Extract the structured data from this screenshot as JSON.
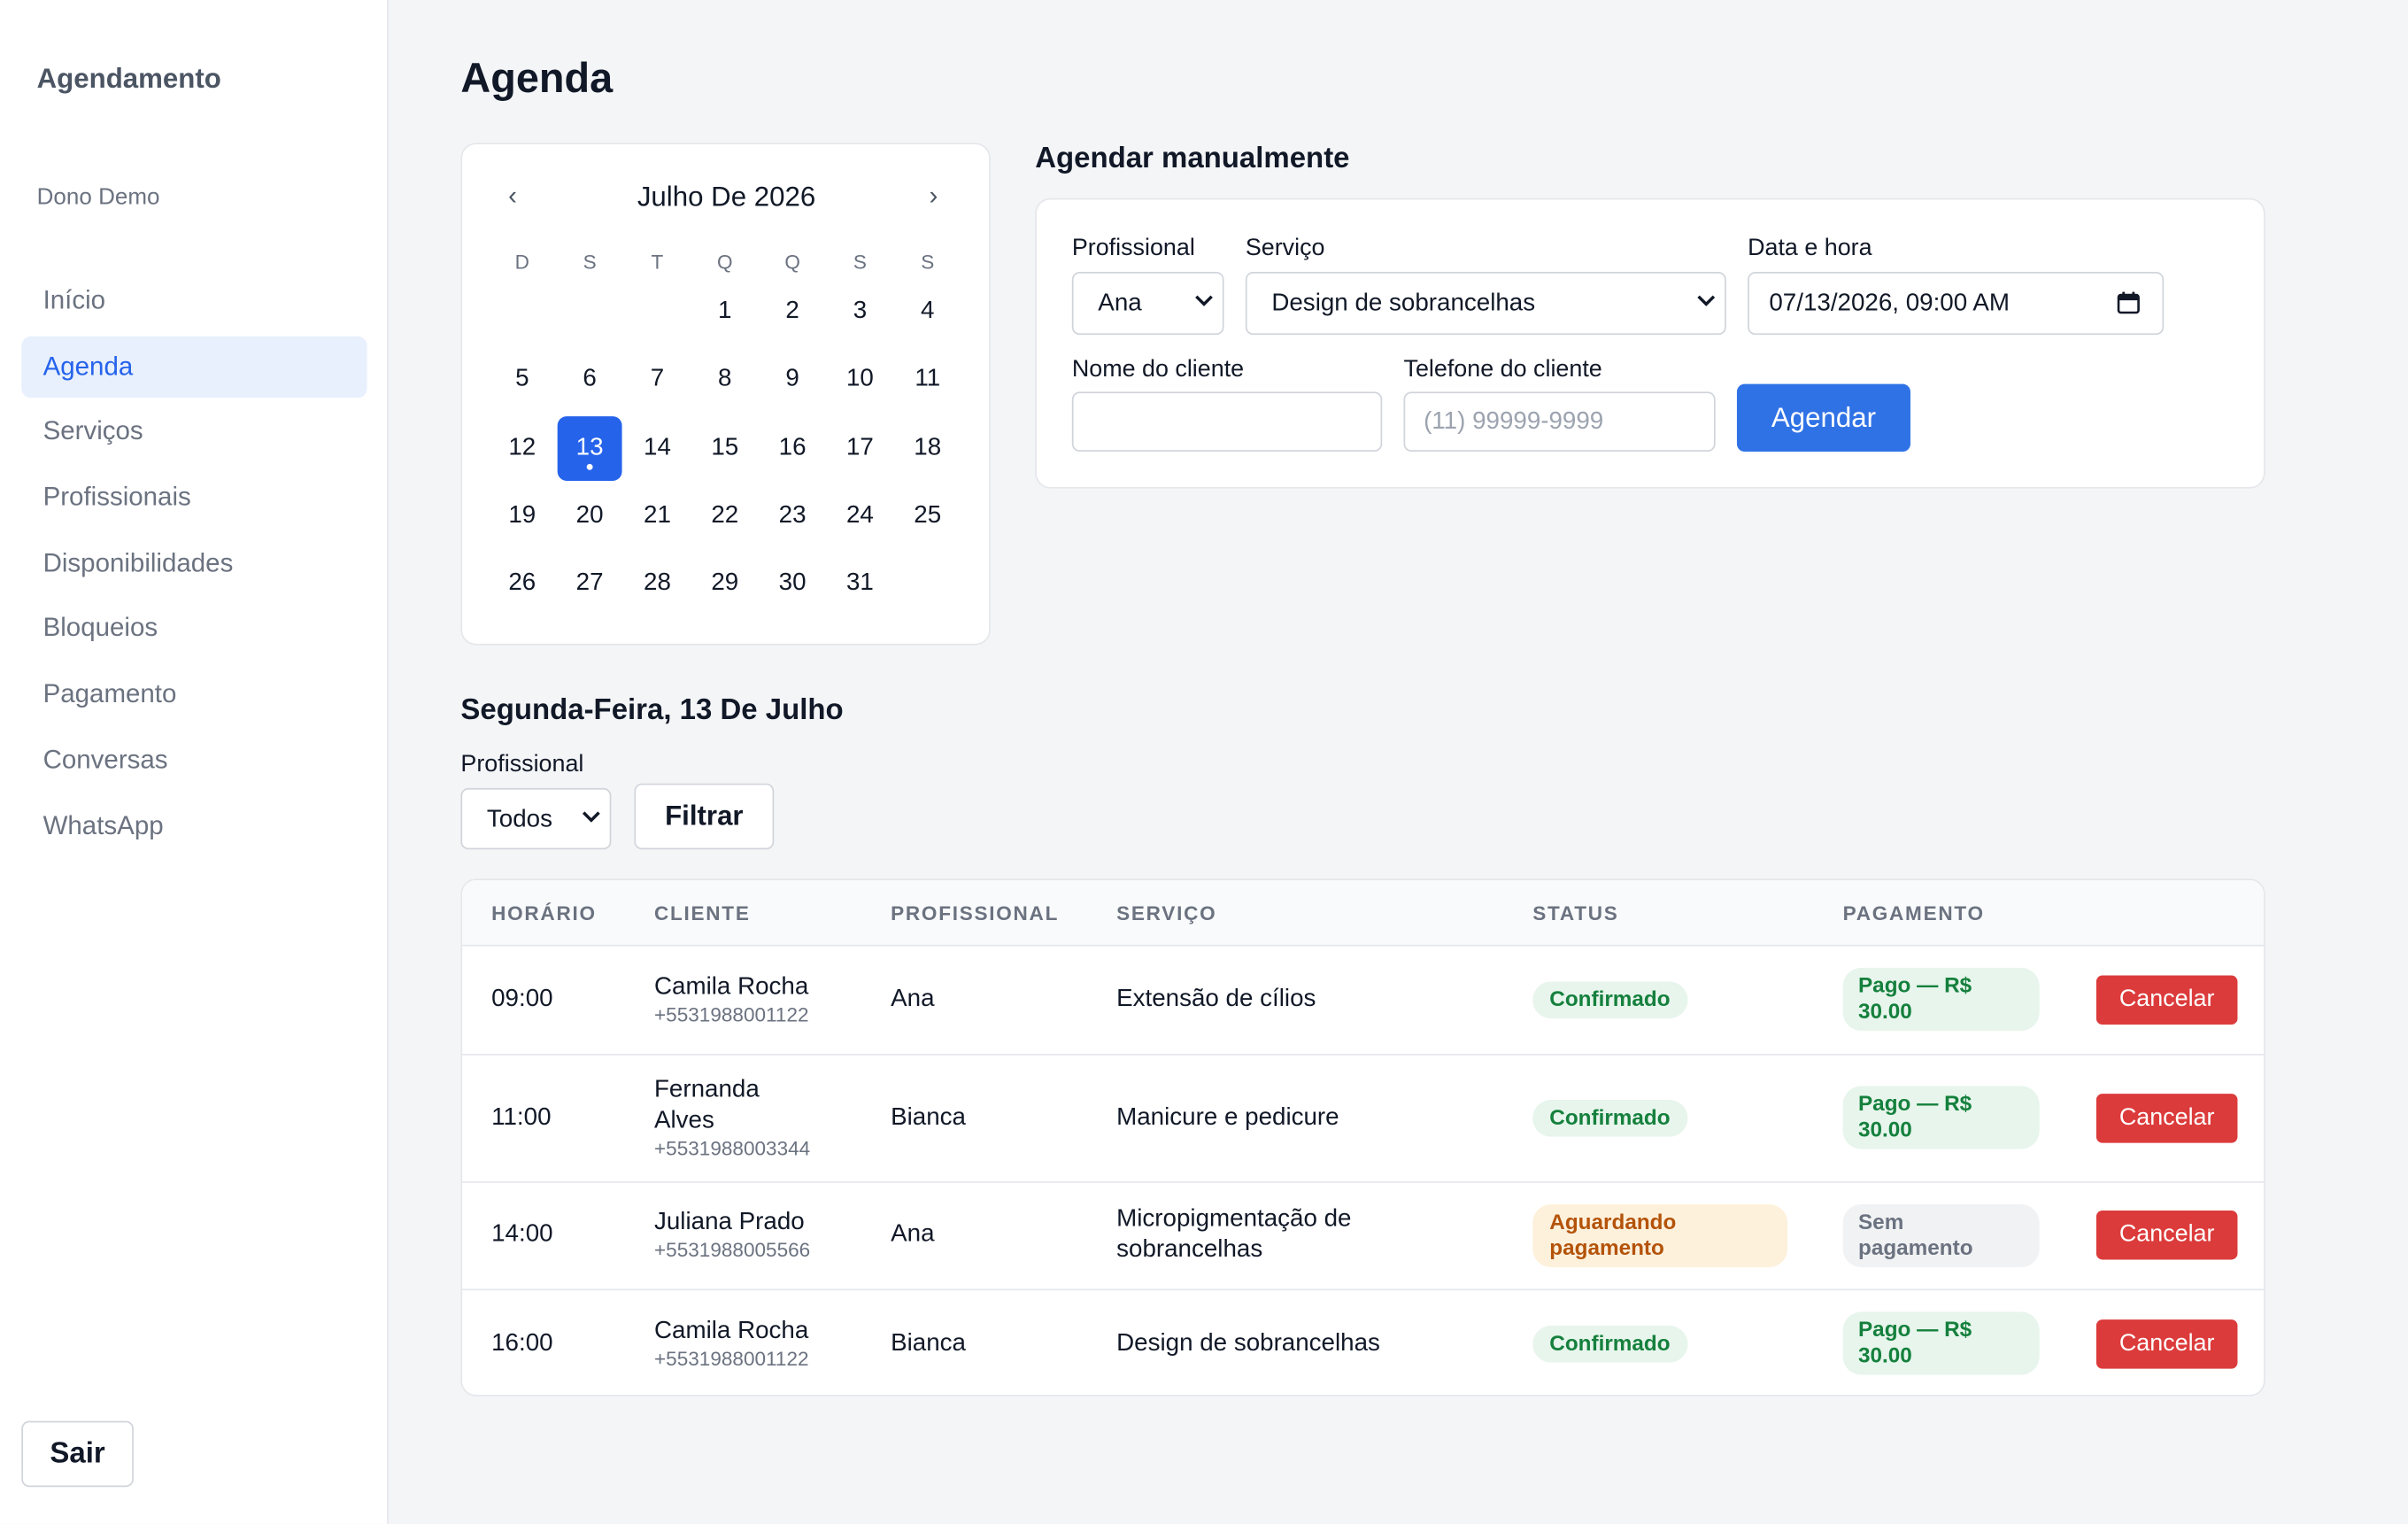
{
  "sidebar": {
    "brand": "Agendamento",
    "user": "Dono Demo",
    "items": [
      {
        "label": "Início",
        "active": false
      },
      {
        "label": "Agenda",
        "active": true
      },
      {
        "label": "Serviços",
        "active": false
      },
      {
        "label": "Profissionais",
        "active": false
      },
      {
        "label": "Disponibilidades",
        "active": false
      },
      {
        "label": "Bloqueios",
        "active": false
      },
      {
        "label": "Pagamento",
        "active": false
      },
      {
        "label": "Conversas",
        "active": false
      },
      {
        "label": "WhatsApp",
        "active": false
      }
    ],
    "logout_label": "Sair"
  },
  "page_title": "Agenda",
  "calendar": {
    "month_label": "Julho De 2026",
    "prev_label": "‹",
    "next_label": "›",
    "weekdays": [
      "D",
      "S",
      "T",
      "Q",
      "Q",
      "S",
      "S"
    ],
    "first_weekday_index": 3,
    "days_in_month": 31,
    "selected_day": 13,
    "days_with_appointments": [
      13
    ]
  },
  "manual_booking": {
    "title": "Agendar manualmente",
    "professional_label": "Profissional",
    "professional_value": "Ana",
    "service_label": "Serviço",
    "service_value": "Design de sobrancelhas",
    "datetime_label": "Data e hora",
    "datetime_value": "07/13/2026, 09:00 AM",
    "client_name_label": "Nome do cliente",
    "client_name_value": "",
    "client_phone_label": "Telefone do cliente",
    "client_phone_placeholder": "(11) 99999-9999",
    "submit_label": "Agendar"
  },
  "day_view": {
    "heading": "Segunda-Feira, 13 De Julho",
    "filter_label": "Profissional",
    "filter_value": "Todos",
    "filter_button": "Filtrar"
  },
  "table": {
    "columns": [
      "HORÁRIO",
      "CLIENTE",
      "PROFISSIONAL",
      "SERVIÇO",
      "STATUS",
      "PAGAMENTO"
    ],
    "cancel_label": "Cancelar",
    "rows": [
      {
        "time": "09:00",
        "client_line1": "Camila Rocha",
        "client_line2": "",
        "phone": "+5531988001122",
        "professional": "Ana",
        "service_line1": "Extensão de cílios",
        "service_line2": "",
        "status_line1": "Confirmado",
        "status_line2": "",
        "status_kind": "green",
        "payment_line1": "Pago — R$",
        "payment_line2": "30.00",
        "payment_kind": "green"
      },
      {
        "time": "11:00",
        "client_line1": "Fernanda",
        "client_line2": "Alves",
        "phone": "+5531988003344",
        "professional": "Bianca",
        "service_line1": "Manicure e pedicure",
        "service_line2": "",
        "status_line1": "Confirmado",
        "status_line2": "",
        "status_kind": "green",
        "payment_line1": "Pago — R$",
        "payment_line2": "30.00",
        "payment_kind": "green"
      },
      {
        "time": "14:00",
        "client_line1": "Juliana Prado",
        "client_line2": "",
        "phone": "+5531988005566",
        "professional": "Ana",
        "service_line1": "Micropigmentação de",
        "service_line2": "sobrancelhas",
        "status_line1": "Aguardando",
        "status_line2": "pagamento",
        "status_kind": "amber",
        "payment_line1": "Sem",
        "payment_line2": "pagamento",
        "payment_kind": "gray"
      },
      {
        "time": "16:00",
        "client_line1": "Camila Rocha",
        "client_line2": "",
        "phone": "+5531988001122",
        "professional": "Bianca",
        "service_line1": "Design de sobrancelhas",
        "service_line2": "",
        "status_line1": "Confirmado",
        "status_line2": "",
        "status_kind": "green",
        "payment_line1": "Pago — R$",
        "payment_line2": "30.00",
        "payment_kind": "green"
      }
    ]
  },
  "colors": {
    "accent": "#2563eb",
    "danger": "#dc3b3b",
    "success_text": "#15803d",
    "warning_text": "#b45309"
  }
}
